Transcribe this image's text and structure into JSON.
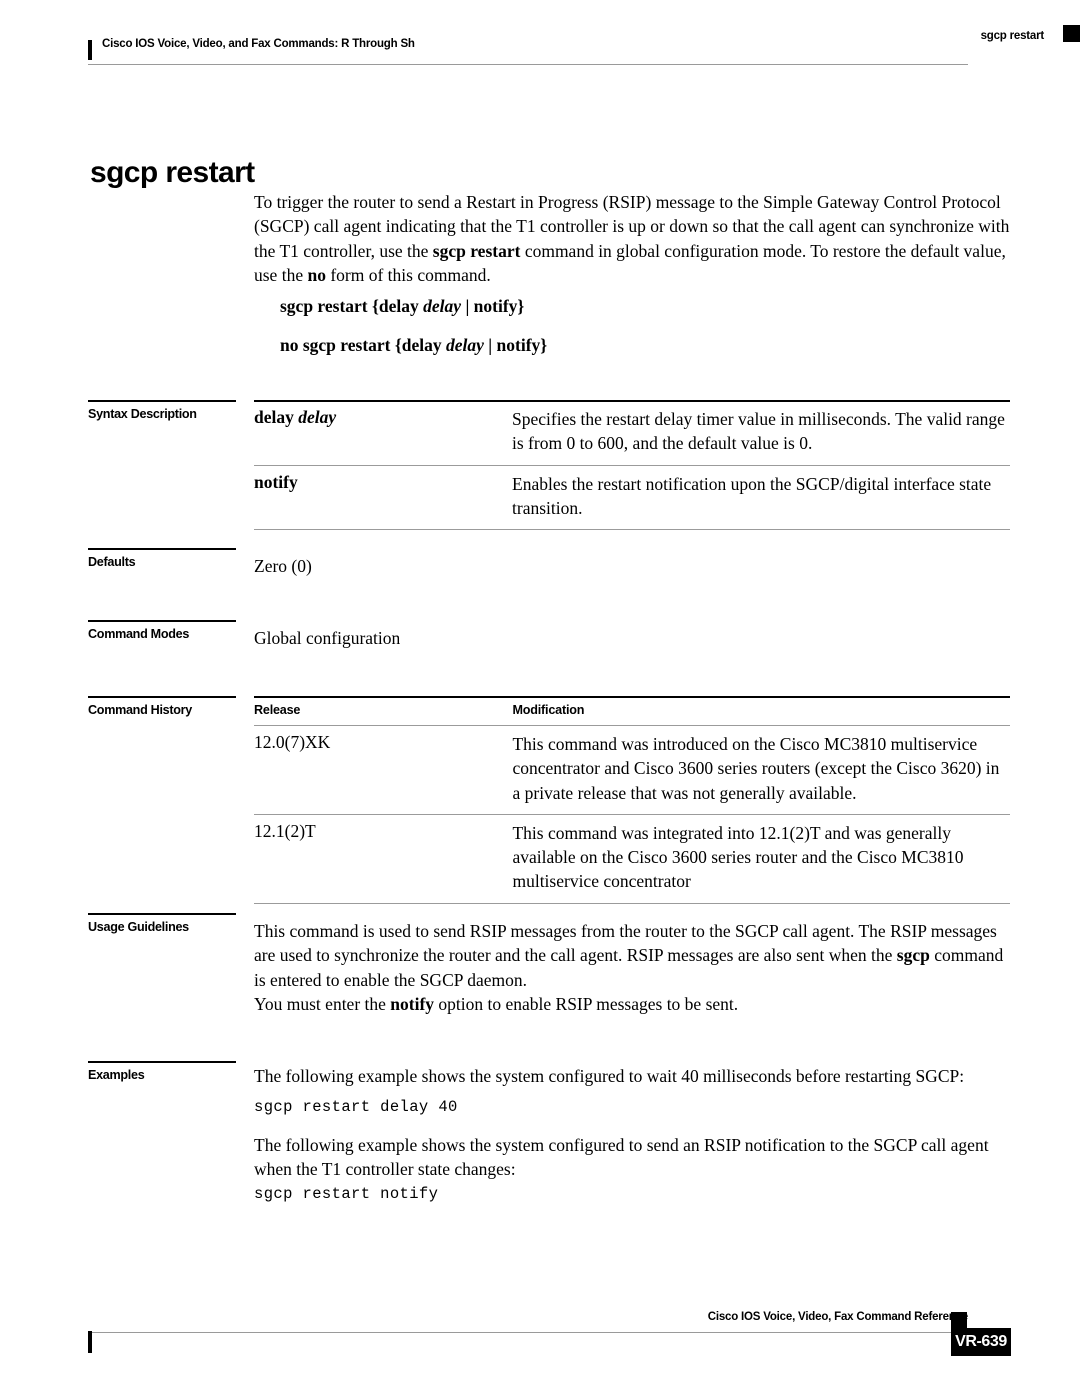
{
  "header": {
    "title": "Cisco IOS Voice, Video, and Fax Commands: R Through Sh",
    "running_head_right": "sgcp restart"
  },
  "command": {
    "name": "sgcp restart",
    "description": "To trigger the router to send a Restart in Progress (RSIP) message to the Simple Gateway Control Protocol (SGCP) call agent indicating that the T1 controller is up or down so that the call agent can synchronize with the T1 controller, use the <b>sgcp restart</b> command in global configuration mode. To restore the default value, use the <b>no</b> form of this command.",
    "syntax": "sgcp restart {delay <i>delay</i> | notify}",
    "syntax_no": "no sgcp restart {delay <i>delay</i> | notify}"
  },
  "sections": {
    "syntax_description": {
      "label": "Syntax Description",
      "rows": [
        {
          "term": "delay <i>delay</i>",
          "description": "Specifies the restart delay timer value in milliseconds. The valid range is from 0 to 600, and the default value is 0."
        },
        {
          "term": "notify",
          "description": "Enables the restart notification upon the SGCP/digital interface state transition."
        }
      ]
    },
    "defaults": {
      "label": "Defaults",
      "value": "Zero (0)"
    },
    "command_modes": {
      "label": "Command Modes",
      "value": "Global configuration"
    },
    "command_history": {
      "label": "Command History",
      "columns": [
        "Release",
        "Modification"
      ],
      "rows": [
        {
          "release": "12.0(7)XK",
          "modification": "This command was introduced on the Cisco MC3810 multiservice concentrator and Cisco 3600 series routers (except the Cisco 3620) in a private release that was not generally available."
        },
        {
          "release": "12.1(2)T",
          "modification": "This command was integrated into 12.1(2)T and was generally available on the Cisco 3600 series router and the Cisco MC3810 multiservice concentrator"
        }
      ]
    },
    "usage_guidelines": {
      "label": "Usage Guidelines",
      "paragraphs": [
        "This command is used to send RSIP messages from the router to the SGCP call agent. The RSIP messages are used to synchronize the router and the call agent. RSIP messages are also sent when the <b>sgcp</b> command is entered to enable the SGCP daemon.",
        "You must enter the <b>notify</b> option to enable RSIP messages to be sent."
      ]
    },
    "examples": {
      "label": "Examples",
      "blocks": [
        {
          "text": "The following example shows the system configured to wait 40 milliseconds before restarting SGCP:",
          "code": "sgcp restart delay 40"
        },
        {
          "text": "The following example shows the system configured to send an RSIP notification to the SGCP call agent when the T1 controller state changes:",
          "code": "sgcp restart notify"
        }
      ]
    }
  },
  "footer": {
    "title": "Cisco IOS Voice, Video, Fax Command Reference",
    "page": "VR-639"
  }
}
